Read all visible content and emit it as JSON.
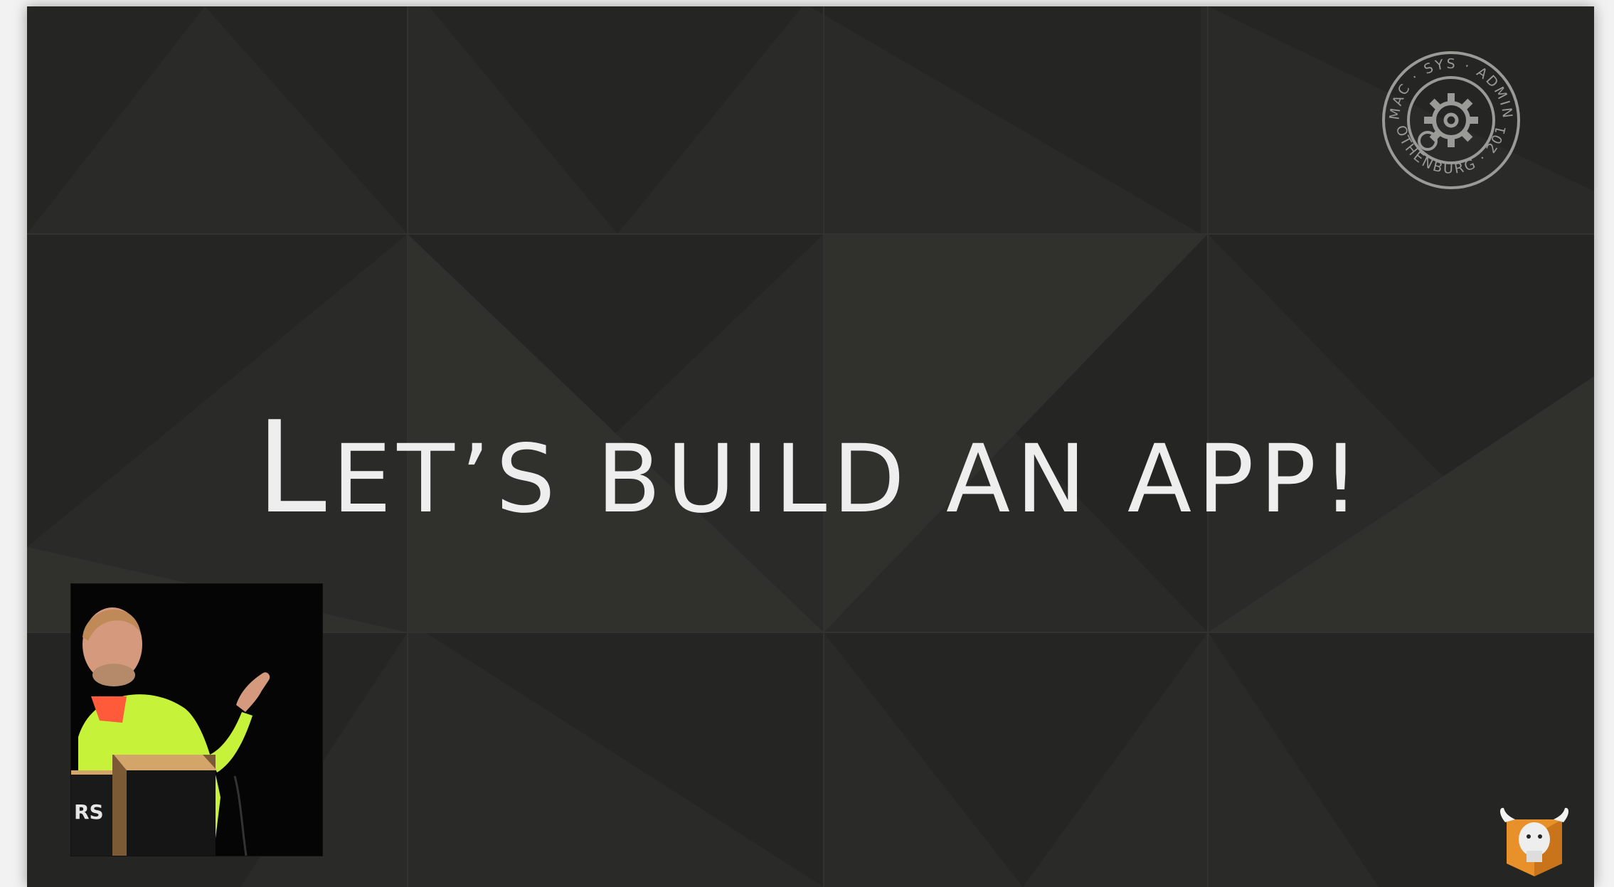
{
  "slide": {
    "title_parts": [
      "L",
      "ET",
      "’",
      "S BUILD AN APP!"
    ],
    "background_color": "#2a2a28",
    "text_color": "#eeeeee"
  },
  "seal": {
    "icon": "gear-seal-icon",
    "top_text": "MAC · SYS · ADMIN",
    "bottom_text": "GOTHENBURG · 2017",
    "color": "#9a9a96"
  },
  "speaker_video": {
    "visible_sign_text": "RS",
    "shirt_color": "#c7f23a"
  },
  "brand_logo": {
    "icon": "deer-head-box-icon",
    "color": "#e8912a"
  }
}
